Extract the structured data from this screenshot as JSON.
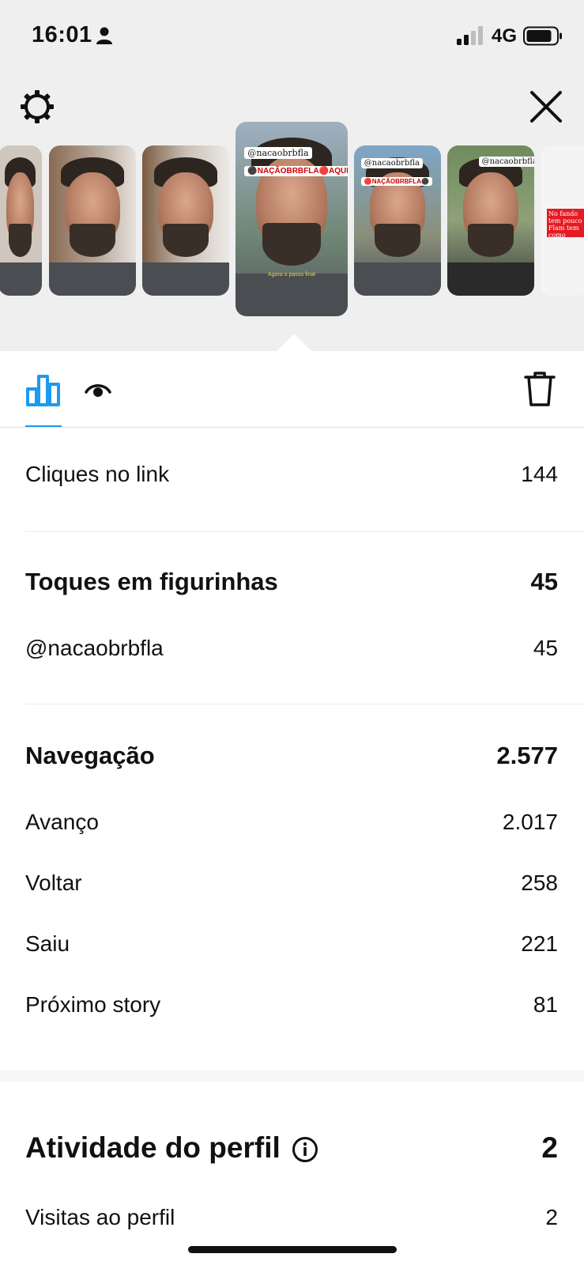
{
  "status_bar": {
    "time": "16:01",
    "network": "4G",
    "icons": [
      "person-icon",
      "signal-icon",
      "battery-icon"
    ]
  },
  "header": {
    "icons": [
      "settings-icon",
      "close-icon"
    ],
    "stories": [
      {
        "sticker_1": "",
        "sticker_2": "",
        "caption": ""
      },
      {
        "sticker_1": "",
        "sticker_2": "",
        "caption": ""
      },
      {
        "sticker_1": "",
        "sticker_2": "",
        "caption": ""
      },
      {
        "sticker_1": "@nacaobrbfla",
        "sticker_2": "⚫NAÇÃOBRBFLA🔴AQUI!",
        "caption": "Agora o passo final"
      },
      {
        "sticker_1": "@nacaobrbfla",
        "sticker_2": "🔴NAÇÃOBRBFLA⚫",
        "caption": ""
      },
      {
        "sticker_1": "@nacaobrbfla",
        "sticker_2": "",
        "caption": ""
      },
      {
        "sticker_1": "",
        "sticker_2": "No fando tem pouco Flam tem como",
        "caption": ""
      }
    ],
    "selected_index": 3
  },
  "tabs": {
    "icons": [
      "bar-chart-icon",
      "eye-icon",
      "trash-icon"
    ],
    "active_color": "#1a9bf0"
  },
  "metrics": {
    "link_clicks": {
      "label": "Cliques no link",
      "value": "144"
    },
    "sticker_taps": {
      "label": "Toques em figurinhas",
      "value": "45",
      "items": [
        {
          "label": "@nacaobrbfla",
          "value": "45"
        }
      ]
    },
    "navigation": {
      "label": "Navegação",
      "value": "2.577",
      "items": [
        {
          "label": "Avanço",
          "value": "2.017"
        },
        {
          "label": "Voltar",
          "value": "258"
        },
        {
          "label": "Saiu",
          "value": "221"
        },
        {
          "label": "Próximo story",
          "value": "81"
        }
      ]
    },
    "profile_activity": {
      "label": "Atividade do perfil",
      "value": "2",
      "items": [
        {
          "label": "Visitas ao perfil",
          "value": "2"
        }
      ]
    }
  }
}
